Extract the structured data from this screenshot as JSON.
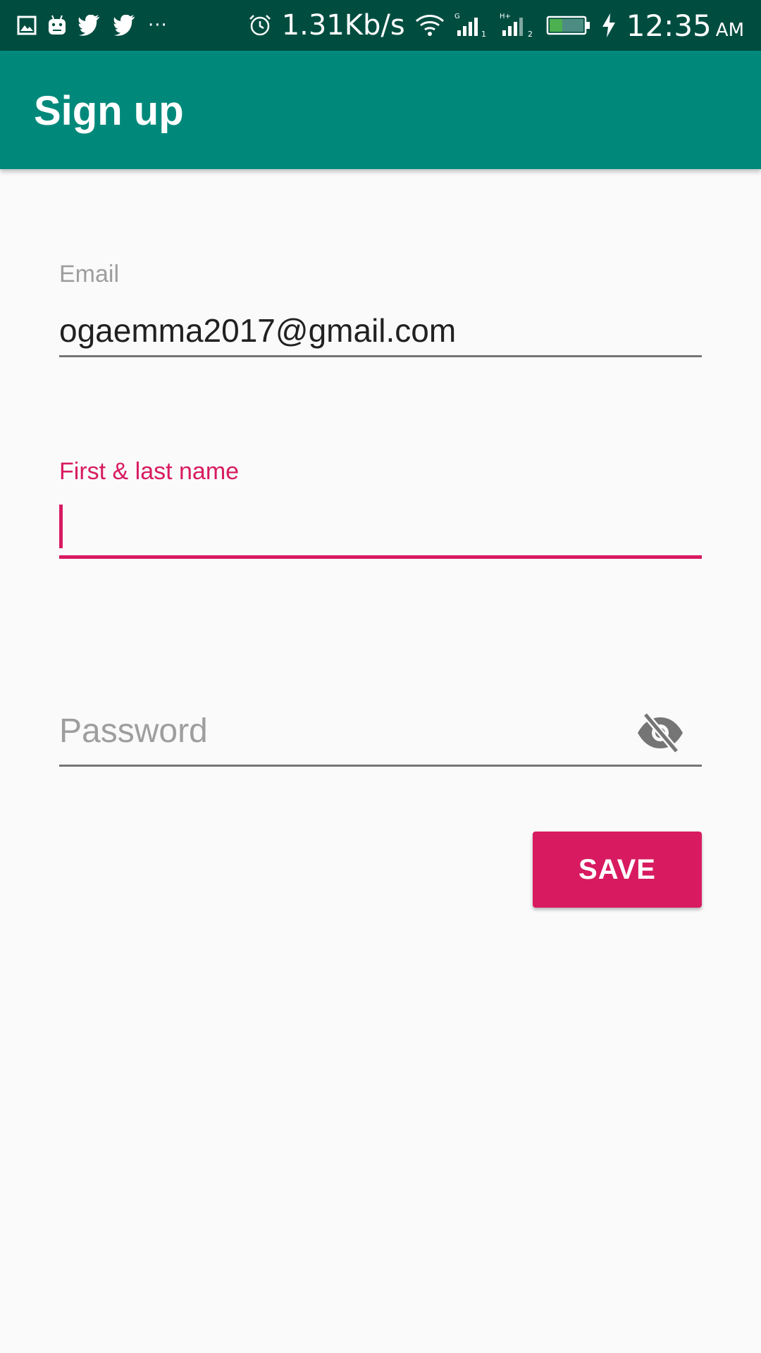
{
  "status_bar": {
    "network_speed": "1.31Kb/s",
    "time": "12:35",
    "ampm": "AM",
    "more": "···",
    "icons": [
      "gallery-icon",
      "android-icon",
      "twitter-icon",
      "twitter-icon",
      "alarm-icon",
      "wifi-icon",
      "signal-sim1-icon",
      "signal-sim2-icon",
      "battery-icon",
      "charging-icon"
    ],
    "sim1_label": "G",
    "sim2_label": "H+"
  },
  "app_bar": {
    "title": "Sign up"
  },
  "form": {
    "email": {
      "label": "Email",
      "value": "ogaemma2017@gmail.com"
    },
    "name": {
      "label": "First & last name",
      "value": ""
    },
    "password": {
      "placeholder": "Password",
      "visibility_icon": "eye-off-icon"
    },
    "save_label": "SAVE"
  },
  "colors": {
    "status_bar": "#004d40",
    "app_bar": "#00897b",
    "accent": "#d81b60",
    "background": "#fafafa"
  }
}
